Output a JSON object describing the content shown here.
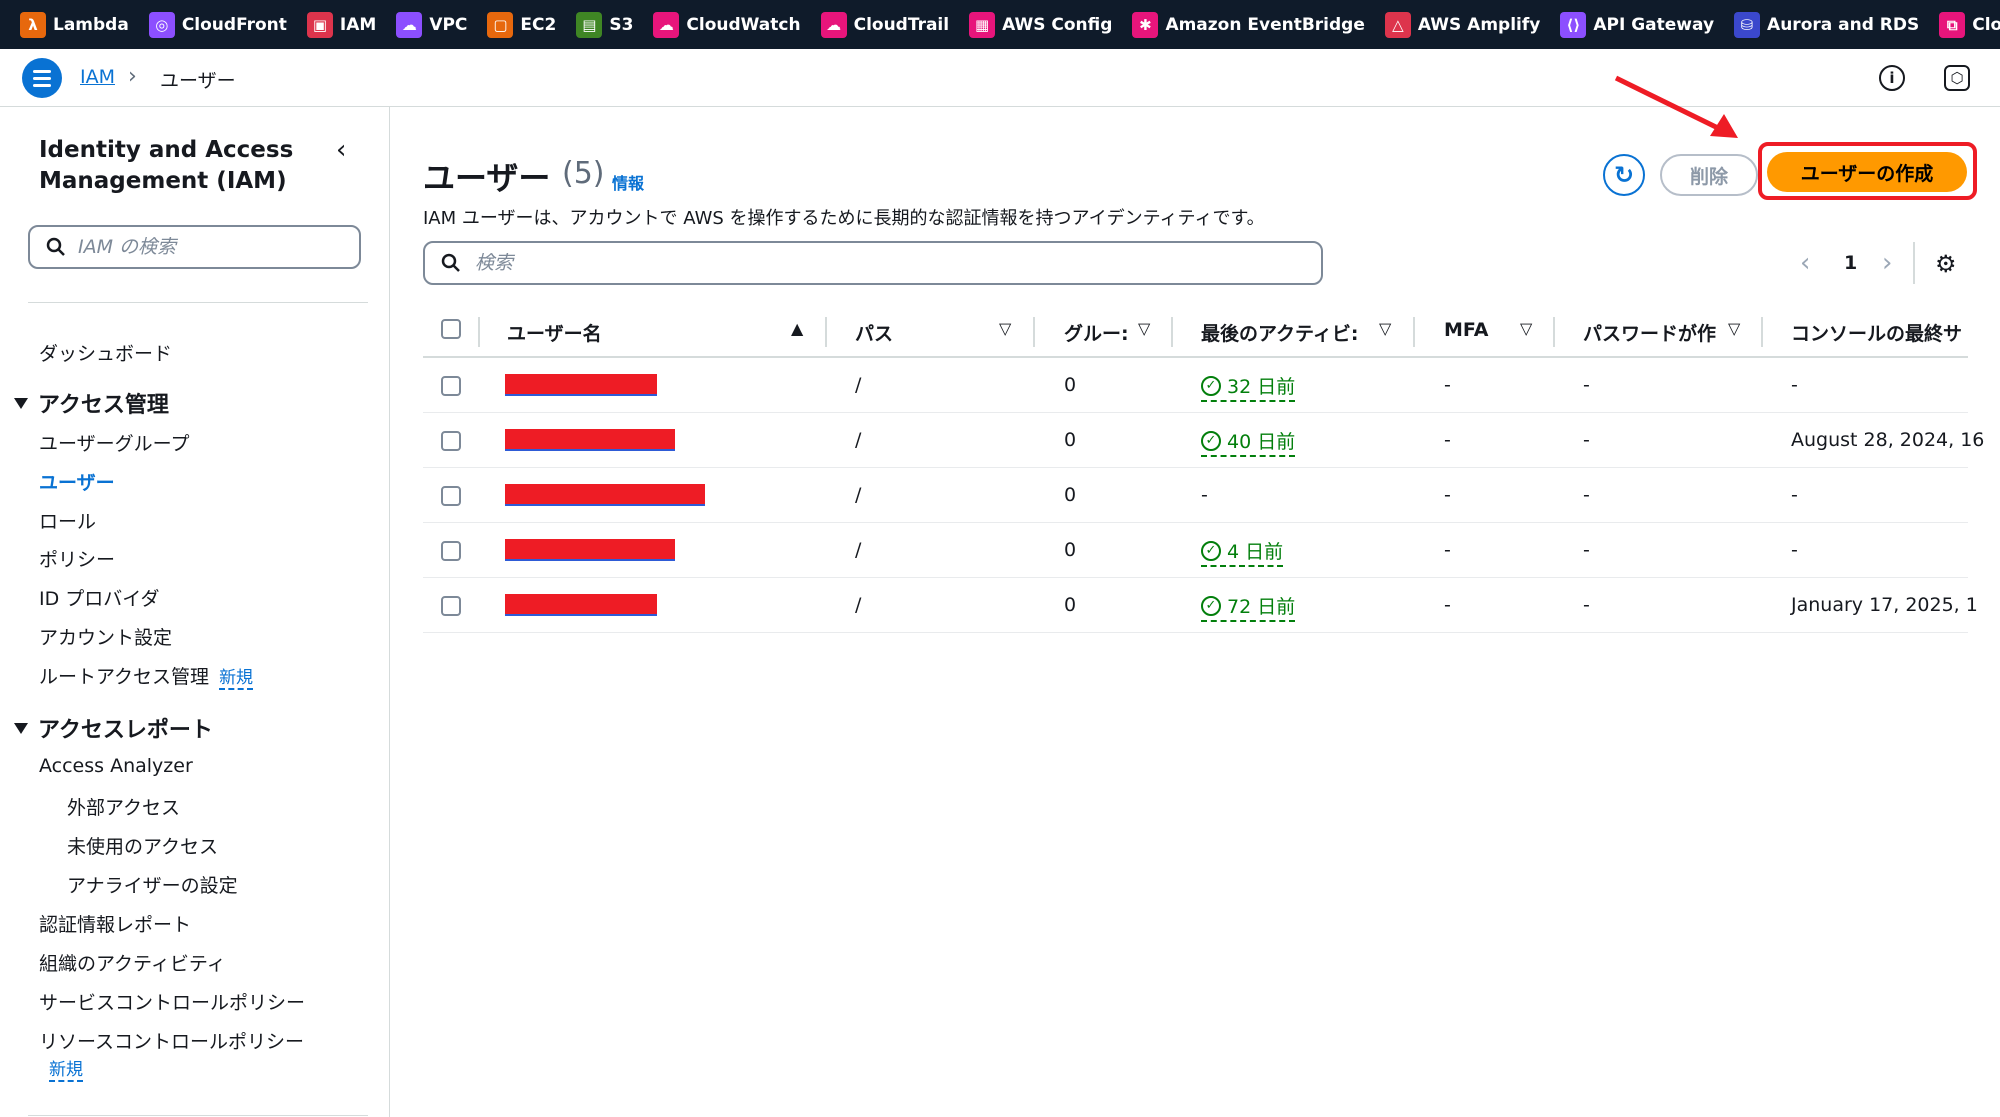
{
  "topbar": {
    "services": [
      {
        "name": "Lambda",
        "icon": "lambda-icon",
        "color": "#e7680d",
        "glyph": "λ"
      },
      {
        "name": "CloudFront",
        "icon": "cloudfront-icon",
        "color": "#8c4fff",
        "glyph": "◎"
      },
      {
        "name": "IAM",
        "icon": "iam-icon",
        "color": "#dd344c",
        "glyph": "▣"
      },
      {
        "name": "VPC",
        "icon": "vpc-icon",
        "color": "#8c4fff",
        "glyph": "☁"
      },
      {
        "name": "EC2",
        "icon": "ec2-icon",
        "color": "#e7680d",
        "glyph": "▢"
      },
      {
        "name": "S3",
        "icon": "s3-icon",
        "color": "#3f8624",
        "glyph": "▤"
      },
      {
        "name": "CloudWatch",
        "icon": "cloudwatch-icon",
        "color": "#e7157b",
        "glyph": "☁"
      },
      {
        "name": "CloudTrail",
        "icon": "cloudtrail-icon",
        "color": "#e7157b",
        "glyph": "☁"
      },
      {
        "name": "AWS Config",
        "icon": "config-icon",
        "color": "#e7157b",
        "glyph": "▦"
      },
      {
        "name": "Amazon EventBridge",
        "icon": "eventbridge-icon",
        "color": "#e7157b",
        "glyph": "✱"
      },
      {
        "name": "AWS Amplify",
        "icon": "amplify-icon",
        "color": "#dd344c",
        "glyph": "△"
      },
      {
        "name": "API Gateway",
        "icon": "apigateway-icon",
        "color": "#8c4fff",
        "glyph": "⟨⟩"
      },
      {
        "name": "Aurora and RDS",
        "icon": "rds-icon",
        "color": "#3b48cc",
        "glyph": "⛁"
      },
      {
        "name": "CloudFormation",
        "icon": "cloudformation-icon",
        "color": "#e7157b",
        "glyph": "⧉"
      }
    ]
  },
  "breadcrumb": {
    "root": "IAM",
    "current": "ユーザー"
  },
  "sidebar": {
    "title": "Identity and Access Management (IAM)",
    "search_placeholder": "IAM の検索",
    "dashboard": "ダッシュボード",
    "access_mgmt": {
      "label": "アクセス管理",
      "items": [
        "ユーザーグループ",
        "ユーザー",
        "ロール",
        "ポリシー",
        "ID プロバイダ",
        "アカウント設定",
        "ルートアクセス管理"
      ],
      "new_label": "新規"
    },
    "access_reports": {
      "label": "アクセスレポート",
      "analyzer": "Access Analyzer",
      "analyzer_items": [
        "外部アクセス",
        "未使用のアクセス",
        "アナライザーの設定"
      ],
      "items": [
        "認証情報レポート",
        "組織のアクティビティ",
        "サービスコントロールポリシー",
        "リソースコントロールポリシー"
      ],
      "new_label": "新規"
    }
  },
  "main": {
    "title": "ユーザー",
    "count": "(5)",
    "info": "情報",
    "description": "IAM ユーザーは、アカウントで AWS を操作するために長期的な認証情報を持つアイデンティティです。",
    "delete_label": "削除",
    "create_label": "ユーザーの作成",
    "search_placeholder": "検索",
    "page": "1",
    "columns": [
      "ユーザー名",
      "パス",
      "グルー:",
      "最後のアクティビ:",
      "MFA",
      "パスワードが作",
      "コンソールの最終サ"
    ]
  },
  "rows": [
    {
      "path": "/",
      "groups": "0",
      "activity": "32 日前",
      "mfa": "-",
      "password": "-",
      "console": "-"
    },
    {
      "path": "/",
      "groups": "0",
      "activity": "40 日前",
      "mfa": "-",
      "password": "-",
      "console": "August 28, 2024, 16"
    },
    {
      "path": "/",
      "groups": "0",
      "activity": "-",
      "mfa": "-",
      "password": "-",
      "console": "-"
    },
    {
      "path": "/",
      "groups": "0",
      "activity": "4 日前",
      "mfa": "-",
      "password": "-",
      "console": "-"
    },
    {
      "path": "/",
      "groups": "0",
      "activity": "72 日前",
      "mfa": "-",
      "password": "-",
      "console": "January 17, 2025, 1"
    }
  ],
  "colors": {
    "accent": "#0972d3",
    "primary_button": "#ff9900",
    "annotation": "#ee1c25",
    "success": "#037f0c"
  }
}
